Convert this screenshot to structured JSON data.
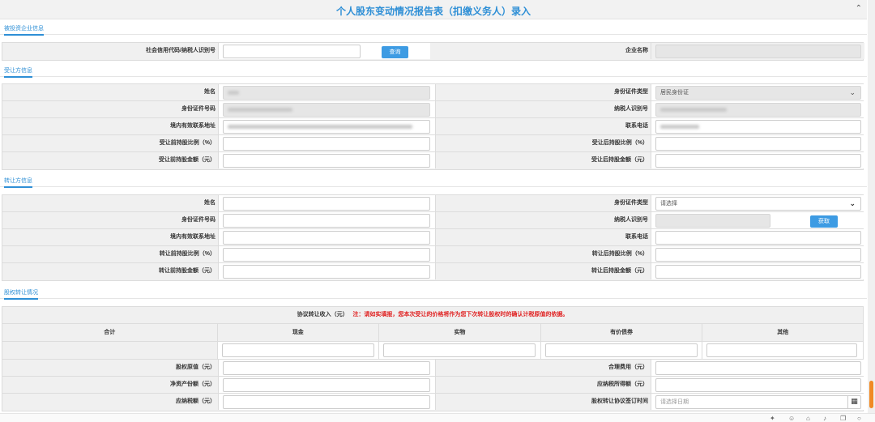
{
  "title": "个人股东变动情况报告表（扣缴义务人）录入",
  "sections": {
    "invested": "被投资企业信息",
    "transferee": "受让方信息",
    "transferor": "转让方信息",
    "equity": "股权转让情况"
  },
  "invested": {
    "credit_code_label": "社会信用代码/纳税人识别号",
    "query_btn": "查询",
    "company_name_label": "企业名称"
  },
  "transferee": {
    "name_label": "姓名",
    "id_type_label": "身份证件类型",
    "id_type_value": "居民身份证",
    "id_no_label": "身份证件号码",
    "taxpayer_id_label": "纳税人识别号",
    "address_label": "境内有效联系地址",
    "phone_label": "联系电话",
    "before_ratio_label": "受让前持股比例（%）",
    "after_ratio_label": "受让后持股比例（%）",
    "before_amount_label": "受让前持股金额（元）",
    "after_amount_label": "受让后持股金额（元）"
  },
  "transferor": {
    "name_label": "姓名",
    "id_type_label": "身份证件类型",
    "id_type_placeholder": "请选择",
    "id_no_label": "身份证件号码",
    "taxpayer_id_label": "纳税人识别号",
    "fetch_btn": "获取",
    "address_label": "境内有效联系地址",
    "phone_label": "联系电话",
    "before_ratio_label": "转让前持股比例（%）",
    "after_ratio_label": "转让后持股比例（%）",
    "before_amount_label": "转让前持股金额（元）",
    "after_amount_label": "转让后持股金额（元）"
  },
  "equity": {
    "income_label": "协议转让收入（元）",
    "note": "注：请如实填报，您本次受让的价格将作为您下次转让股权时的确认计税原值的依据。",
    "col_total": "合计",
    "col_cash": "现金",
    "col_goods": "实物",
    "col_securities": "有价债券",
    "col_other": "其他",
    "original_value_label": "股权原值（元）",
    "reasonable_cost_label": "合理费用（元）",
    "net_assets_label": "净资产份额（元）",
    "taxable_income_label": "应纳税所得额（元）",
    "tax_payable_label": "应纳税额（元）",
    "sign_time_label": "股权转让协议签订时间",
    "date_placeholder": "请选择日期"
  },
  "icons": [
    "chevron-up-icon",
    "chevron-down-icon",
    "calendar-icon",
    "settings-icon",
    "chat-icon",
    "home-icon",
    "sound-icon",
    "copy-icon",
    "search-icon"
  ],
  "colors": {
    "accent": "#2e8fd6",
    "button": "#3d9be3",
    "warning": "#e02020",
    "scroll_thumb": "#f08a24"
  }
}
